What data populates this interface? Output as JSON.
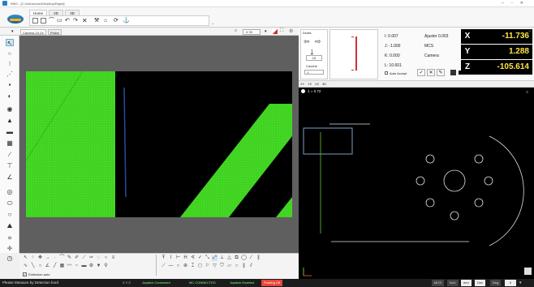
{
  "window": {
    "title": "RMS - [C:\\Users\\user\\Desktop\\Rapid]"
  },
  "ribbon": {
    "tabs": [
      {
        "label": "Home"
      },
      {
        "label": "2D"
      },
      {
        "label": "3D"
      }
    ]
  },
  "camera": {
    "tabs": [
      {
        "label": "Camera 24.1X"
      },
      {
        "label": "Probe"
      }
    ],
    "zoom": "0.78",
    "extension_auto": "Extension auto"
  },
  "probe_panel": {
    "header": "Droits",
    "value": "1",
    "value2": "10",
    "couche_label": "Couche",
    "couche_value": "1"
  },
  "readouts": {
    "i_label": "I: 0.007",
    "j_label": "J: -1.000",
    "k_label": "K: 0.000",
    "l_label": "L: 10.601",
    "ajuster": "Ajuster 0.003",
    "mcs": "MCS",
    "camera": "Camera",
    "auto_accept": "Auto Accept"
  },
  "dro": {
    "x": {
      "axis": "X",
      "value": "-11.736"
    },
    "y": {
      "axis": "Y",
      "value": "1.288"
    },
    "z": {
      "axis": "Z",
      "value": "-105.614"
    }
  },
  "cad": {
    "tabs": [
      {
        "label": "XY"
      },
      {
        "label": "YZ"
      },
      {
        "label": "XZ"
      },
      {
        "label": "3D"
      }
    ],
    "scale": "1 = 0.72"
  },
  "status": {
    "message": "Please Measure by Detection bord",
    "xyz": "X Y Z",
    "joystick_connected": "Joystick Connected",
    "mc_connected": "MC CONNECTED",
    "joystick_enabled": "Joystick Enabled",
    "probing_off": "Probing Off",
    "mcs": "MCS",
    "inch": "Inch",
    "mm": "mm",
    "dec": "Dec",
    "deg": "Deg",
    "zero": "0"
  },
  "colors": {
    "accent_green": "#3cd21e",
    "dro_value": "#ffe44a",
    "cad_line": "#e8e8e8",
    "cad_box": "#7aa0c4"
  }
}
